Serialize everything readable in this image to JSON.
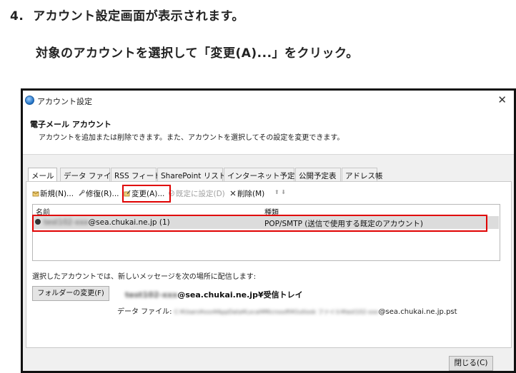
{
  "instruction": {
    "step": "4.  アカウント設定画面が表示されます。",
    "detail": "対象のアカウントを選択して「変更(A)...」をクリック。"
  },
  "dialog": {
    "title": "アカウント設定",
    "close_glyph": "✕",
    "header_title": "電子メール アカウント",
    "header_desc": "アカウントを追加または削除できます。また、アカウントを選択してその設定を変更できます。",
    "tabs": [
      "メール",
      "データ ファイル",
      "RSS フィード",
      "SharePoint リスト",
      "インターネット予定表",
      "公開予定表",
      "アドレス帳"
    ],
    "toolbar": {
      "new": "新規(N)...",
      "repair": "修復(R)...",
      "change": "変更(A)...",
      "set_default": "既定に設定(D)",
      "remove": "削除(M)",
      "arrows": "⬆ ⬇"
    },
    "list": {
      "col_name": "名前",
      "col_type": "種類",
      "rows": [
        {
          "name_prefix": "test102-xxx",
          "name_suffix": "@sea.chukai.ne.jp (1)",
          "type": "POP/SMTP (送信で使用する既定のアカウント)"
        }
      ]
    },
    "deliver_label": "選択したアカウントでは、新しいメッセージを次の場所に配信します:",
    "folder_button": "フォルダーの変更(F)",
    "deliver_prefix": "test102-xxx",
    "deliver_suffix": "@sea.chukai.ne.jp¥受信トレイ",
    "datafile_label": "データ ファイル: ",
    "datafile_prefix": "C:¥Users¥xxx¥AppData¥Local¥Microsoft¥Outlook ファイル¥test102-xxx",
    "datafile_suffix": "@sea.chukai.ne.jp.pst",
    "close_button": "閉じる(C)"
  },
  "colors": {
    "highlight": "#e00000",
    "dialog_bg": "#f0f0f0",
    "selected_row": "#dcdcdc"
  }
}
